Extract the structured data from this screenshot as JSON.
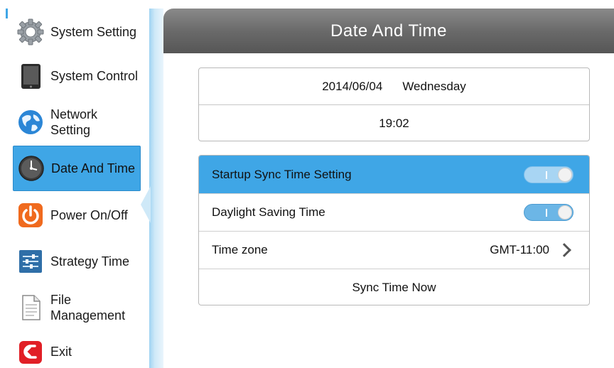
{
  "sidebar": {
    "items": [
      {
        "label": "System Setting",
        "icon": "gear-icon"
      },
      {
        "label": "System Control",
        "icon": "tablet-icon"
      },
      {
        "label": "Network Setting",
        "icon": "globe-icon"
      },
      {
        "label": "Date And Time",
        "icon": "clock-icon",
        "active": true
      },
      {
        "label": "Power On/Off",
        "icon": "power-icon"
      },
      {
        "label": "Strategy Time",
        "icon": "sliders-icon"
      },
      {
        "label": "File",
        "label2": "Management",
        "icon": "document-icon"
      },
      {
        "label": "Exit",
        "icon": "exit-icon"
      }
    ]
  },
  "header": {
    "title": "Date And Time"
  },
  "datetime": {
    "date": "2014/06/04",
    "weekday": "Wednesday",
    "time": "19:02"
  },
  "settings": {
    "startup_sync": {
      "label": "Startup Sync Time Setting",
      "enabled": true
    },
    "daylight_saving": {
      "label": "Daylight Saving Time",
      "enabled": true
    },
    "time_zone": {
      "label": "Time zone",
      "value": "GMT-11:00"
    },
    "sync_now": {
      "label": "Sync Time Now"
    }
  },
  "colors": {
    "accent": "#3fa6e6",
    "header": "#6a6a6a",
    "toggle_on": "#6cb6e6"
  }
}
